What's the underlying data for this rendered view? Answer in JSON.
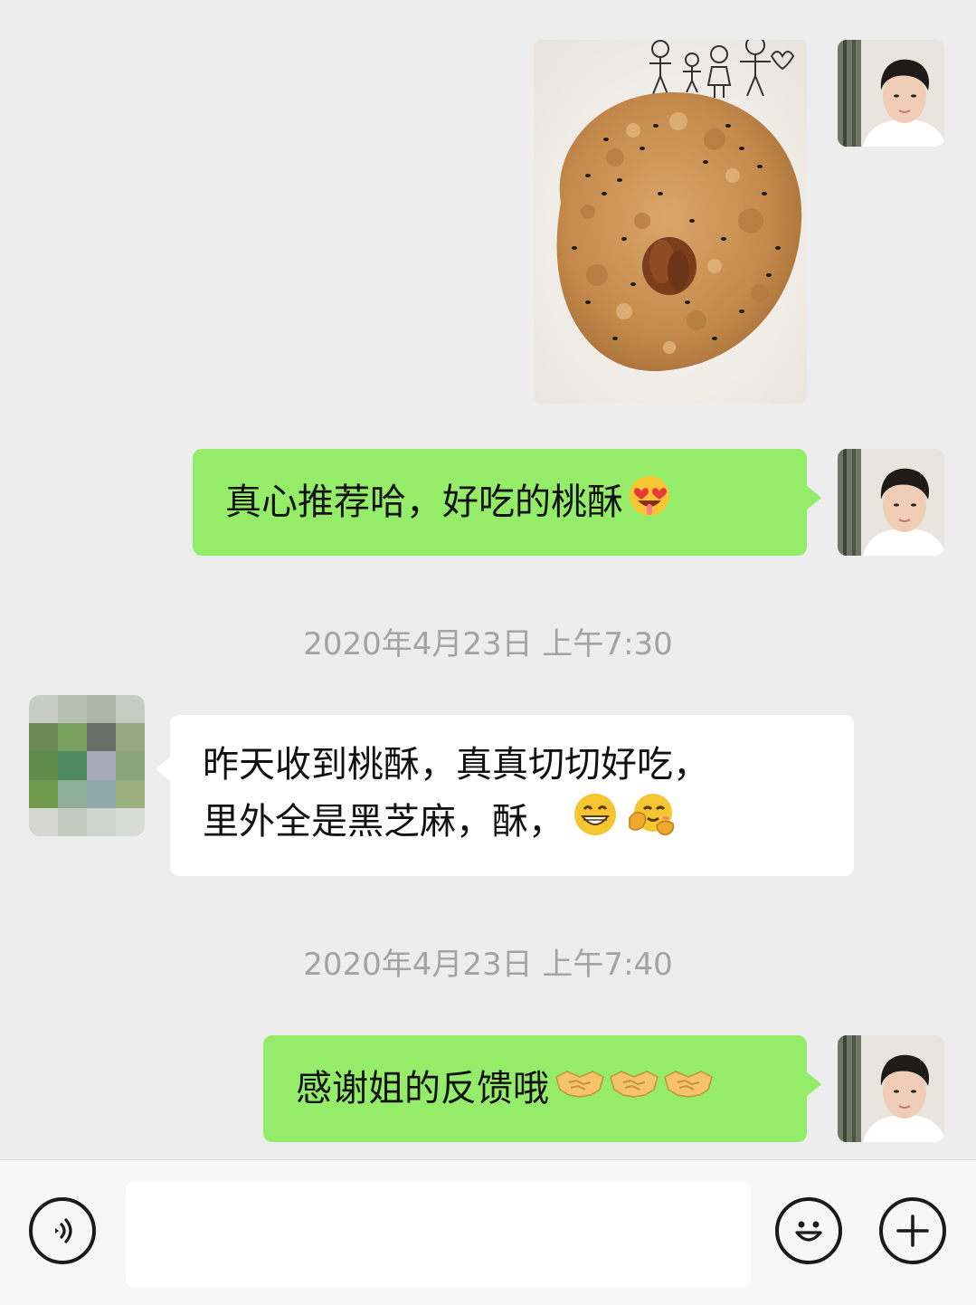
{
  "messages": {
    "m2_text": "真心推荐哈，好吃的桃酥",
    "ts1": "2020年4月23日 上午7:30",
    "m3_line1": "昨天收到桃酥，真真切切好吃，",
    "m3_line2": "里外全是黑芝麻，酥，",
    "ts2": "2020年4月23日 上午7:40",
    "m4_text": "感谢姐的反馈哦"
  },
  "emoji_names": [
    "heart-eyes-drool-emoji",
    "grin-emoji",
    "hug-emoji",
    "handshake-emoji"
  ],
  "colors": {
    "background": "#ededed",
    "sent_bubble": "#95ec69",
    "received_bubble": "#ffffff",
    "timestamp": "#a3a3a3"
  },
  "input": {
    "value": "",
    "placeholder": ""
  },
  "toolbar_icons": [
    "voice-icon",
    "emoji-icon",
    "plus-icon"
  ]
}
